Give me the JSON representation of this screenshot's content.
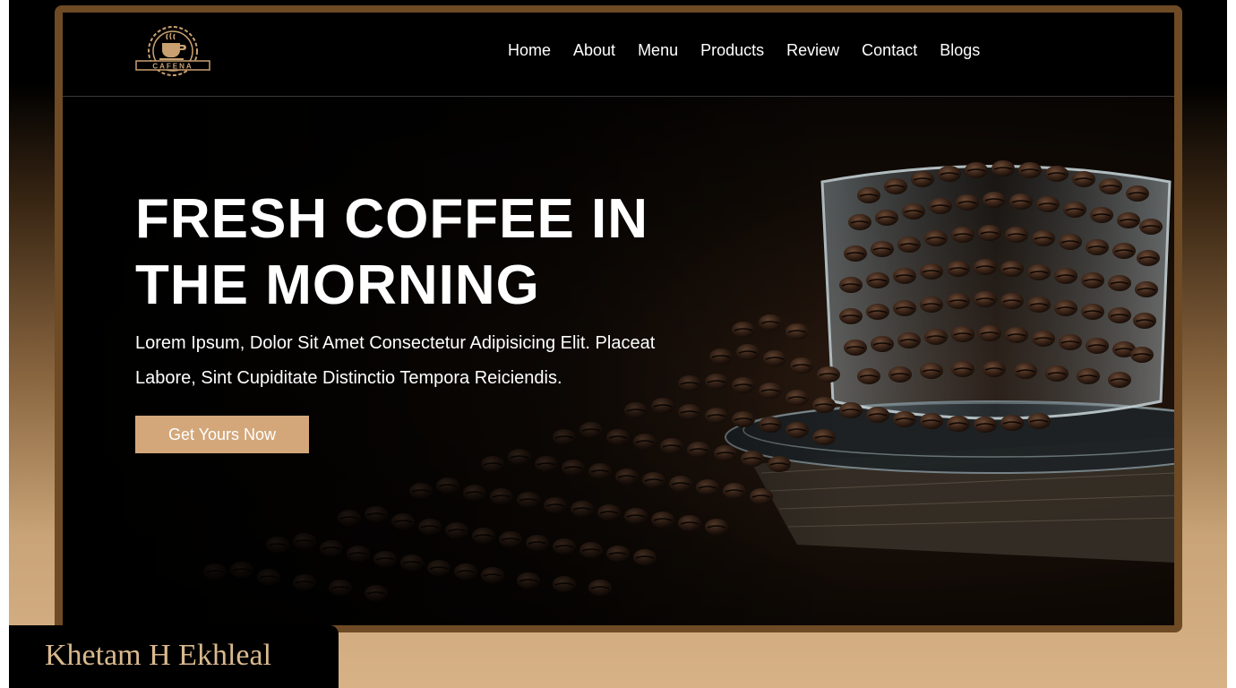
{
  "logo": {
    "text": "CAFENA",
    "icon": "coffee-cup-gear-logo"
  },
  "nav": {
    "items": [
      {
        "label": "Home"
      },
      {
        "label": "About"
      },
      {
        "label": "Menu"
      },
      {
        "label": "Products"
      },
      {
        "label": "Review"
      },
      {
        "label": "Contact"
      },
      {
        "label": "Blogs"
      }
    ]
  },
  "hero": {
    "title_line1": "FRESH COFFEE IN",
    "title_line2": "THE MORNING",
    "text_line1": "Lorem Ipsum, Dolor Sit Amet Consectetur Adipisicing Elit. Placeat",
    "text_line2": "Labore, Sint Cupiditate Distinctio Tempora Reiciendis.",
    "cta_label": "Get Yours Now"
  },
  "credit": {
    "name": "Khetam H Ekhleal"
  },
  "colors": {
    "accent": "#d3a77a",
    "frame": "#6e4a25",
    "credit_text": "#d9b98e"
  }
}
